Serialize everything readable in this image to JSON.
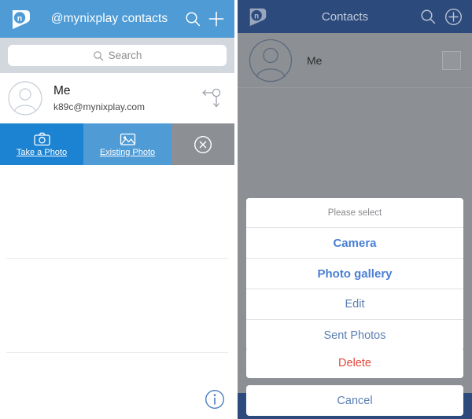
{
  "left_panel": {
    "header": {
      "logo": "nixplay-logo-icon",
      "title": "@mynixplay contacts",
      "search_icon": "search-icon",
      "add_icon": "plus-icon"
    },
    "search": {
      "placeholder": "Search",
      "icon": "search-icon",
      "value": ""
    },
    "contact": {
      "avatar": "person-avatar-icon",
      "name": "Me",
      "email": "k89c@mynixplay.com",
      "action_icon": "share-branch-icon"
    },
    "action_bar": {
      "take_photo": {
        "label": "Take a Photo",
        "icon": "camera-icon",
        "color": "#1c82d2"
      },
      "existing_photo": {
        "label": "Existing Photo",
        "icon": "image-icon",
        "color": "#4e9bd6"
      },
      "close": {
        "icon": "close-circle-icon",
        "color": "#8c8f94"
      }
    },
    "info_icon": "info-circle-icon"
  },
  "right_panel": {
    "header": {
      "logo": "nixplay-logo-icon",
      "title": "Contacts",
      "search_icon": "search-icon",
      "add_icon": "plus-circle-icon"
    },
    "contact": {
      "avatar": "person-avatar-icon",
      "name": "Me",
      "checkbox": "checkbox-unchecked-icon"
    },
    "action_sheet": {
      "title": "Please select",
      "items": [
        {
          "label": "Camera",
          "style": "strong"
        },
        {
          "label": "Photo gallery",
          "style": "strong"
        },
        {
          "label": "Edit",
          "style": "normal"
        },
        {
          "label": "Sent Photos",
          "style": "normal"
        }
      ],
      "destructive": {
        "label": "Delete",
        "style": "danger"
      },
      "cancel": {
        "label": "Cancel",
        "style": "normal"
      }
    }
  },
  "colors": {
    "header_blue": "#4e9bd6",
    "dark_header_navy": "#2c4a7c",
    "take_photo_blue": "#1c82d2",
    "close_gray": "#8c8f94",
    "search_band": "#d3d7de",
    "sheet_blue": "#4a7fd4",
    "delete_red": "#e2493c",
    "info_blue": "#4a7fbf"
  }
}
